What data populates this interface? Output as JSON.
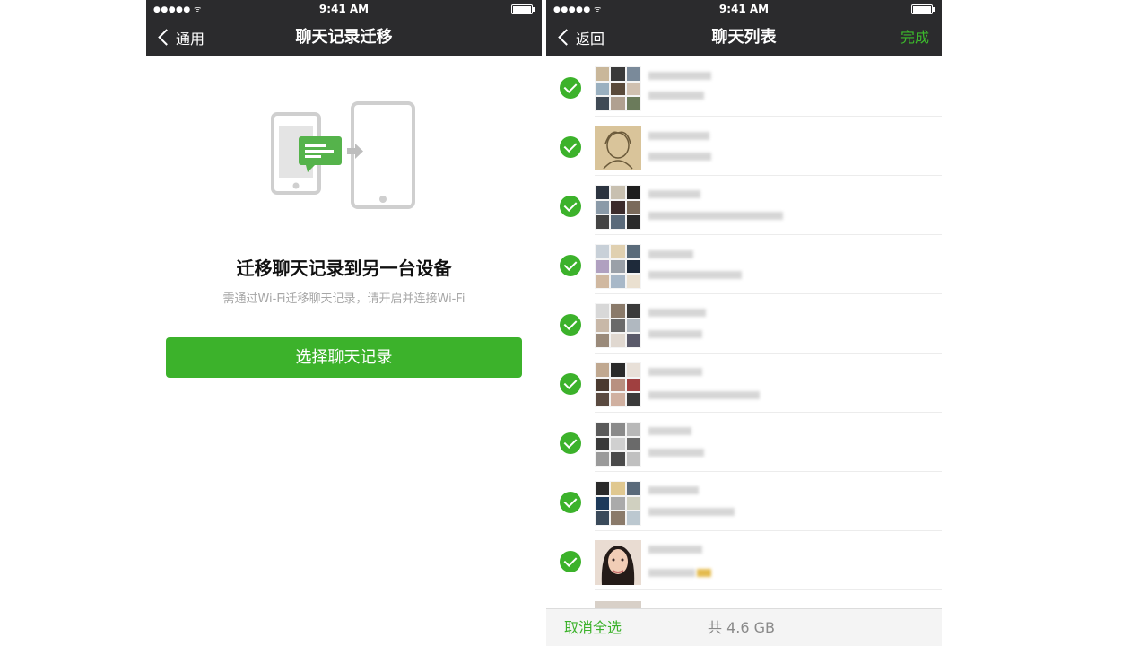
{
  "left": {
    "status": {
      "signal": "●●●●● ᯤ",
      "time": "9:41 AM"
    },
    "nav": {
      "back": "通用",
      "title": "聊天记录迁移"
    },
    "headline": "迁移聊天记录到另一台设备",
    "subtext": "需通过Wi-Fi迁移聊天记录，请开启并连接Wi-Fi",
    "button": "选择聊天记录"
  },
  "right": {
    "status": {
      "signal": "●●●●● ᯤ",
      "time": "9:41 AM"
    },
    "nav": {
      "back": "返回",
      "title": "聊天列表",
      "done": "完成"
    },
    "rows_checked": [
      true,
      true,
      true,
      true,
      true,
      true,
      true,
      true,
      true
    ],
    "bottom": {
      "cancel_all": "取消全选",
      "total": "共 4.6 GB"
    }
  },
  "colors": {
    "bar": "#2b2b2d",
    "accent": "#3cb22b"
  },
  "icons": [
    "signal-icon",
    "wifi-icon",
    "battery-icon",
    "back-chevron-icon",
    "transfer-illustration",
    "check-icon"
  ]
}
